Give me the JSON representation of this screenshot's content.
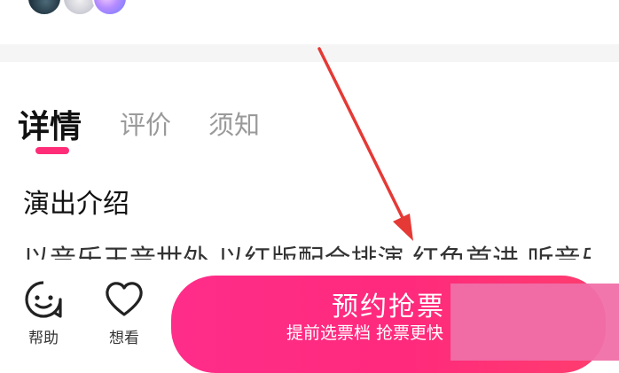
{
  "header": {
    "avatars": [
      {
        "icon": "avatar-dark"
      },
      {
        "icon": "avatar-light"
      },
      {
        "icon": "avatar-purple"
      }
    ]
  },
  "tabs": [
    {
      "label": "详情",
      "active": true
    },
    {
      "label": "评价",
      "active": false
    },
    {
      "label": "须知",
      "active": false
    }
  ],
  "details": {
    "section_title": "演出介绍",
    "description_peek": "以音乐王音世外 以红版配合排演 红色首进 听音乐"
  },
  "bottom_bar": {
    "help_label": "帮助",
    "want_label": "想看",
    "book_button_main": "预约抢票",
    "book_button_sub": "提前选票档 抢票更快"
  },
  "annotation": {
    "arrow_color": "#e53935",
    "overlay_color": "#f06fa8"
  },
  "colors": {
    "accent": "#ff2d78",
    "button_gradient_start": "#ff2d8a",
    "button_gradient_end": "#ff3d6e"
  }
}
